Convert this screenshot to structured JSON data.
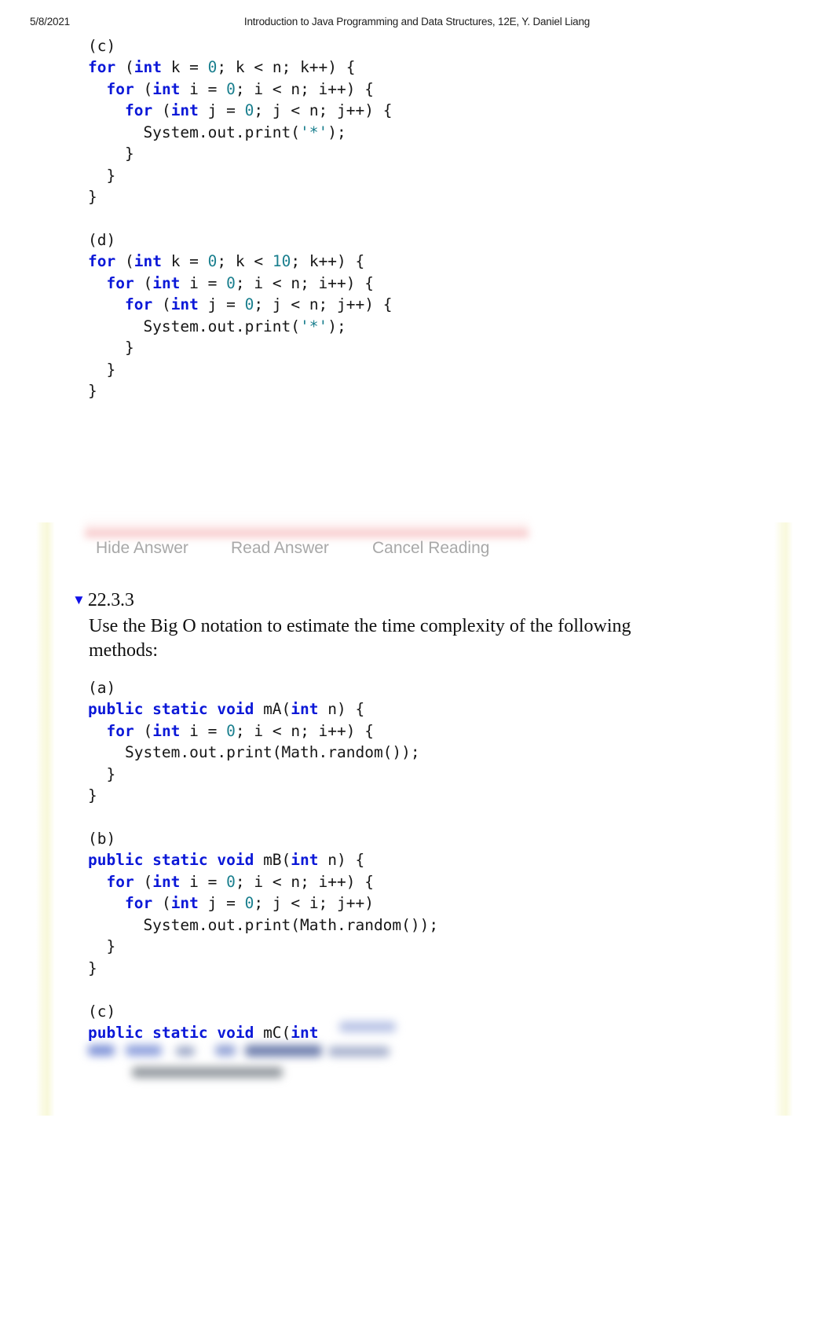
{
  "header": {
    "date": "5/8/2021",
    "title": "Introduction to Java Programming and Data Structures, 12E, Y. Daniel Liang"
  },
  "code_blocks": {
    "c_top": {
      "label": "(c)",
      "lines": [
        [
          {
            "t": "for",
            "c": "kw"
          },
          {
            "t": " (",
            "c": "lbl"
          },
          {
            "t": "int",
            "c": "kw"
          },
          {
            "t": " k = ",
            "c": "lbl"
          },
          {
            "t": "0",
            "c": "num"
          },
          {
            "t": "; k < n; k++) {",
            "c": "lbl"
          }
        ],
        [
          {
            "t": "  ",
            "c": "lbl"
          },
          {
            "t": "for",
            "c": "kw"
          },
          {
            "t": " (",
            "c": "lbl"
          },
          {
            "t": "int",
            "c": "kw"
          },
          {
            "t": " i = ",
            "c": "lbl"
          },
          {
            "t": "0",
            "c": "num"
          },
          {
            "t": "; i < n; i++) {",
            "c": "lbl"
          }
        ],
        [
          {
            "t": "    ",
            "c": "lbl"
          },
          {
            "t": "for",
            "c": "kw"
          },
          {
            "t": " (",
            "c": "lbl"
          },
          {
            "t": "int",
            "c": "kw"
          },
          {
            "t": " j = ",
            "c": "lbl"
          },
          {
            "t": "0",
            "c": "num"
          },
          {
            "t": "; j < n; j++) {",
            "c": "lbl"
          }
        ],
        [
          {
            "t": "      System.out.print(",
            "c": "lbl"
          },
          {
            "t": "'*'",
            "c": "str"
          },
          {
            "t": ");",
            "c": "lbl"
          }
        ],
        [
          {
            "t": "    }",
            "c": "lbl"
          }
        ],
        [
          {
            "t": "  }",
            "c": "lbl"
          }
        ],
        [
          {
            "t": "}",
            "c": "lbl"
          }
        ]
      ]
    },
    "d_top": {
      "label": "(d)",
      "lines": [
        [
          {
            "t": "for",
            "c": "kw"
          },
          {
            "t": " (",
            "c": "lbl"
          },
          {
            "t": "int",
            "c": "kw"
          },
          {
            "t": " k = ",
            "c": "lbl"
          },
          {
            "t": "0",
            "c": "num"
          },
          {
            "t": "; k < ",
            "c": "lbl"
          },
          {
            "t": "10",
            "c": "num"
          },
          {
            "t": "; k++) {",
            "c": "lbl"
          }
        ],
        [
          {
            "t": "  ",
            "c": "lbl"
          },
          {
            "t": "for",
            "c": "kw"
          },
          {
            "t": " (",
            "c": "lbl"
          },
          {
            "t": "int",
            "c": "kw"
          },
          {
            "t": " i = ",
            "c": "lbl"
          },
          {
            "t": "0",
            "c": "num"
          },
          {
            "t": "; i < n; i++) {",
            "c": "lbl"
          }
        ],
        [
          {
            "t": "    ",
            "c": "lbl"
          },
          {
            "t": "for",
            "c": "kw"
          },
          {
            "t": " (",
            "c": "lbl"
          },
          {
            "t": "int",
            "c": "kw"
          },
          {
            "t": " j = ",
            "c": "lbl"
          },
          {
            "t": "0",
            "c": "num"
          },
          {
            "t": "; j < n; j++) {",
            "c": "lbl"
          }
        ],
        [
          {
            "t": "      System.out.print(",
            "c": "lbl"
          },
          {
            "t": "'*'",
            "c": "str"
          },
          {
            "t": ");",
            "c": "lbl"
          }
        ],
        [
          {
            "t": "    }",
            "c": "lbl"
          }
        ],
        [
          {
            "t": "  }",
            "c": "lbl"
          }
        ],
        [
          {
            "t": "}",
            "c": "lbl"
          }
        ]
      ]
    },
    "a_bottom": {
      "label": "(a)",
      "lines": [
        [
          {
            "t": "public static void",
            "c": "kw"
          },
          {
            "t": " mA(",
            "c": "lbl"
          },
          {
            "t": "int",
            "c": "kw"
          },
          {
            "t": " n) {",
            "c": "lbl"
          }
        ],
        [
          {
            "t": "  ",
            "c": "lbl"
          },
          {
            "t": "for",
            "c": "kw"
          },
          {
            "t": " (",
            "c": "lbl"
          },
          {
            "t": "int",
            "c": "kw"
          },
          {
            "t": " i = ",
            "c": "lbl"
          },
          {
            "t": "0",
            "c": "num"
          },
          {
            "t": "; i < n; i++) {",
            "c": "lbl"
          }
        ],
        [
          {
            "t": "    System.out.print(Math.random());",
            "c": "lbl"
          }
        ],
        [
          {
            "t": "  }",
            "c": "lbl"
          }
        ],
        [
          {
            "t": "}",
            "c": "lbl"
          }
        ]
      ]
    },
    "b_bottom": {
      "label": "(b)",
      "lines": [
        [
          {
            "t": "public static void",
            "c": "kw"
          },
          {
            "t": " mB(",
            "c": "lbl"
          },
          {
            "t": "int",
            "c": "kw"
          },
          {
            "t": " n) {",
            "c": "lbl"
          }
        ],
        [
          {
            "t": "  ",
            "c": "lbl"
          },
          {
            "t": "for",
            "c": "kw"
          },
          {
            "t": " (",
            "c": "lbl"
          },
          {
            "t": "int",
            "c": "kw"
          },
          {
            "t": " i = ",
            "c": "lbl"
          },
          {
            "t": "0",
            "c": "num"
          },
          {
            "t": "; i < n; i++) {",
            "c": "lbl"
          }
        ],
        [
          {
            "t": "    ",
            "c": "lbl"
          },
          {
            "t": "for",
            "c": "kw"
          },
          {
            "t": " (",
            "c": "lbl"
          },
          {
            "t": "int",
            "c": "kw"
          },
          {
            "t": " j = ",
            "c": "lbl"
          },
          {
            "t": "0",
            "c": "num"
          },
          {
            "t": "; j < i; j++)",
            "c": "lbl"
          }
        ],
        [
          {
            "t": "      System.out.print(Math.random());",
            "c": "lbl"
          }
        ],
        [
          {
            "t": "  }",
            "c": "lbl"
          }
        ],
        [
          {
            "t": "}",
            "c": "lbl"
          }
        ]
      ]
    },
    "c_bottom": {
      "label": "(c)",
      "lines": [
        [
          {
            "t": "public static void",
            "c": "kw"
          },
          {
            "t": " mC(",
            "c": "lbl"
          },
          {
            "t": "int",
            "c": "kw"
          },
          {
            "t": "",
            "c": "lbl"
          }
        ]
      ]
    }
  },
  "answer_actions": [
    {
      "label": "Hide Answer"
    },
    {
      "label": "Read Answer"
    },
    {
      "label": "Cancel Reading"
    }
  ],
  "section": {
    "triangle": "▼",
    "number": "22.3.3",
    "text": "Use the Big O notation to estimate the time complexity of the following methods:"
  }
}
